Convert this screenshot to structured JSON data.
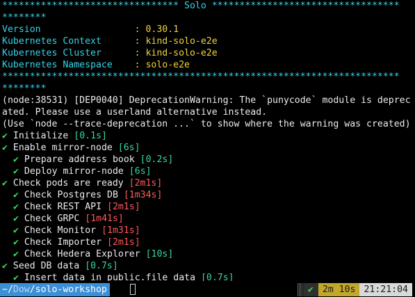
{
  "banner": {
    "top": "******************************** Solo **********************************",
    "top_wrap": "********",
    "bottom": "************************************************************************",
    "bottom_wrap": "********"
  },
  "info": [
    {
      "label": "Version                 ",
      "sep": ": ",
      "value": "0.30.1"
    },
    {
      "label": "Kubernetes Context      ",
      "sep": ": ",
      "value": "kind-solo-e2e"
    },
    {
      "label": "Kubernetes Cluster      ",
      "sep": ": ",
      "value": "kind-solo-e2e"
    },
    {
      "label": "Kubernetes Namespace    ",
      "sep": ": ",
      "value": "solo-e2e"
    }
  ],
  "warning": [
    "(node:38531) [DEP0040] DeprecationWarning: The `punycode` module is deprec",
    "ated. Please use a userland alternative instead.",
    "(Use `node --trace-deprecation ...` to show where the warning was created)"
  ],
  "tasks": [
    {
      "label": "Initialize ",
      "time": "[0.1s]",
      "level": 0,
      "slow": false
    },
    {
      "label": "Enable mirror-node ",
      "time": "[6s]",
      "level": 0,
      "slow": false
    },
    {
      "label": "Prepare address book ",
      "time": "[0.2s]",
      "level": 1,
      "slow": false
    },
    {
      "label": "Deploy mirror-node ",
      "time": "[6s]",
      "level": 1,
      "slow": false
    },
    {
      "label": "Check pods are ready ",
      "time": "[2m1s]",
      "level": 0,
      "slow": true
    },
    {
      "label": "Check Postgres DB ",
      "time": "[1m34s]",
      "level": 1,
      "slow": true
    },
    {
      "label": "Check REST API ",
      "time": "[2m1s]",
      "level": 1,
      "slow": true
    },
    {
      "label": "Check GRPC ",
      "time": "[1m41s]",
      "level": 1,
      "slow": true
    },
    {
      "label": "Check Monitor ",
      "time": "[1m31s]",
      "level": 1,
      "slow": true
    },
    {
      "label": "Check Importer ",
      "time": "[2m1s]",
      "level": 1,
      "slow": true
    },
    {
      "label": "Check Hedera Explorer ",
      "time": "[10s]",
      "level": 1,
      "slow": false
    },
    {
      "label": "Seed DB data ",
      "time": "[0.7s]",
      "level": 0,
      "slow": false
    },
    {
      "label": "Insert data in public.file_data ",
      "time": "[0.7s]",
      "level": 1,
      "slow": false
    }
  ],
  "check_glyph": "✔",
  "prompt": {
    "prefix": "~/",
    "dim_dir": "Dow",
    "path_rest": "/solo-workshop"
  },
  "status": {
    "result_icon": "✔",
    "duration": "2m 10s",
    "clock": "21:21:04"
  }
}
